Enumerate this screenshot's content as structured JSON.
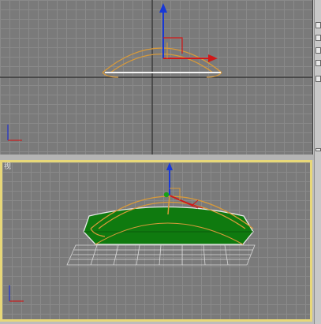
{
  "viewports": {
    "top": {
      "name": "top-viewport",
      "label": ""
    },
    "perspective": {
      "name": "perspective-viewport",
      "label": "视",
      "active": true
    }
  },
  "colors": {
    "grid": "#8a8a8a",
    "background": "#7a7a7a",
    "active_border": "#e8d878",
    "gizmo_orange": "#d89a3a",
    "axis_x": "#d01818",
    "axis_y": "#18a018",
    "axis_z": "#1838d8",
    "object_fill": "#0f7a0f"
  },
  "icons": [
    "axis-tripod-icon",
    "move-gizmo-icon"
  ]
}
